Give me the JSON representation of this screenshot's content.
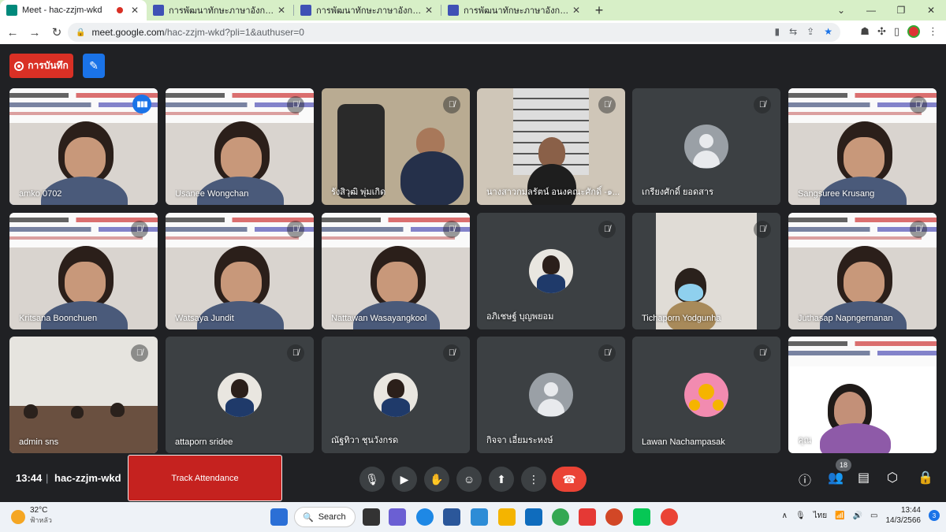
{
  "browser": {
    "tabs": [
      {
        "title": "Meet - hac-zzjm-wkd",
        "active": true,
        "recording": true,
        "favicon_color": "#00897b"
      },
      {
        "title": "การพัฒนาทักษะภาษาอังกฤษ English",
        "active": false,
        "favicon_color": "#3f51b5"
      },
      {
        "title": "การพัฒนาทักษะภาษาอังกฤษ English",
        "active": false,
        "favicon_color": "#3f51b5"
      },
      {
        "title": "การพัฒนาทักษะภาษาอังกฤษ English",
        "active": false,
        "favicon_color": "#3f51b5"
      }
    ],
    "new_tab_icon": "+",
    "url_host": "meet.google.com",
    "url_path": "/hac-zzjm-wkd?pli=1&authuser=0",
    "tab_bar_color": "#d7efc7"
  },
  "meet": {
    "record_label": "การบันทึก",
    "participants": [
      {
        "name": "amko 0702",
        "speaking": true,
        "kind": "banner"
      },
      {
        "name": "Usanee Wongchan",
        "kind": "banner"
      },
      {
        "name": "รังสิวุฒิ พุ่มเกิด",
        "kind": "office"
      },
      {
        "name": "นางสาวกมลรัตน์ อนงคณะศักดิ์ -๑...",
        "kind": "shelf"
      },
      {
        "name": "เกรียงศักดิ์ ยอดสาร",
        "kind": "default"
      },
      {
        "name": "Sangsuree Krusang",
        "kind": "banner"
      },
      {
        "name": "Kritsana Boonchuen",
        "kind": "banner"
      },
      {
        "name": "Watsaya Jundit",
        "kind": "banner"
      },
      {
        "name": "Nattawan Wasayangkool",
        "kind": "banner"
      },
      {
        "name": "อภิเชษฐ์ บุญพยอม",
        "kind": "photo"
      },
      {
        "name": "Tichaporn Yodgunha",
        "kind": "room"
      },
      {
        "name": "Juthasap Napngernanan",
        "kind": "banner"
      },
      {
        "name": "admin sns",
        "kind": "classroom"
      },
      {
        "name": "attaporn sridee",
        "kind": "photo"
      },
      {
        "name": "ณัฐทิวา ชุนวังกรด",
        "kind": "photo"
      },
      {
        "name": "กิจจา เอี่ยมระหงษ์",
        "kind": "default"
      },
      {
        "name": "Lawan Nachampasak",
        "kind": "flower"
      },
      {
        "name": "คุณ",
        "kind": "self"
      }
    ],
    "time": "13:44",
    "separator": "|",
    "meeting_code": "hac-zzjm-wkd",
    "track_attendance_label": "Track Attendance",
    "participant_count": "18"
  },
  "taskbar": {
    "temperature": "32°C",
    "weather_desc": "ฟ้าหลัว",
    "search_label": "Search",
    "language": "ไทย",
    "time": "13:44",
    "date": "14/3/2566",
    "notification_count": "3"
  }
}
